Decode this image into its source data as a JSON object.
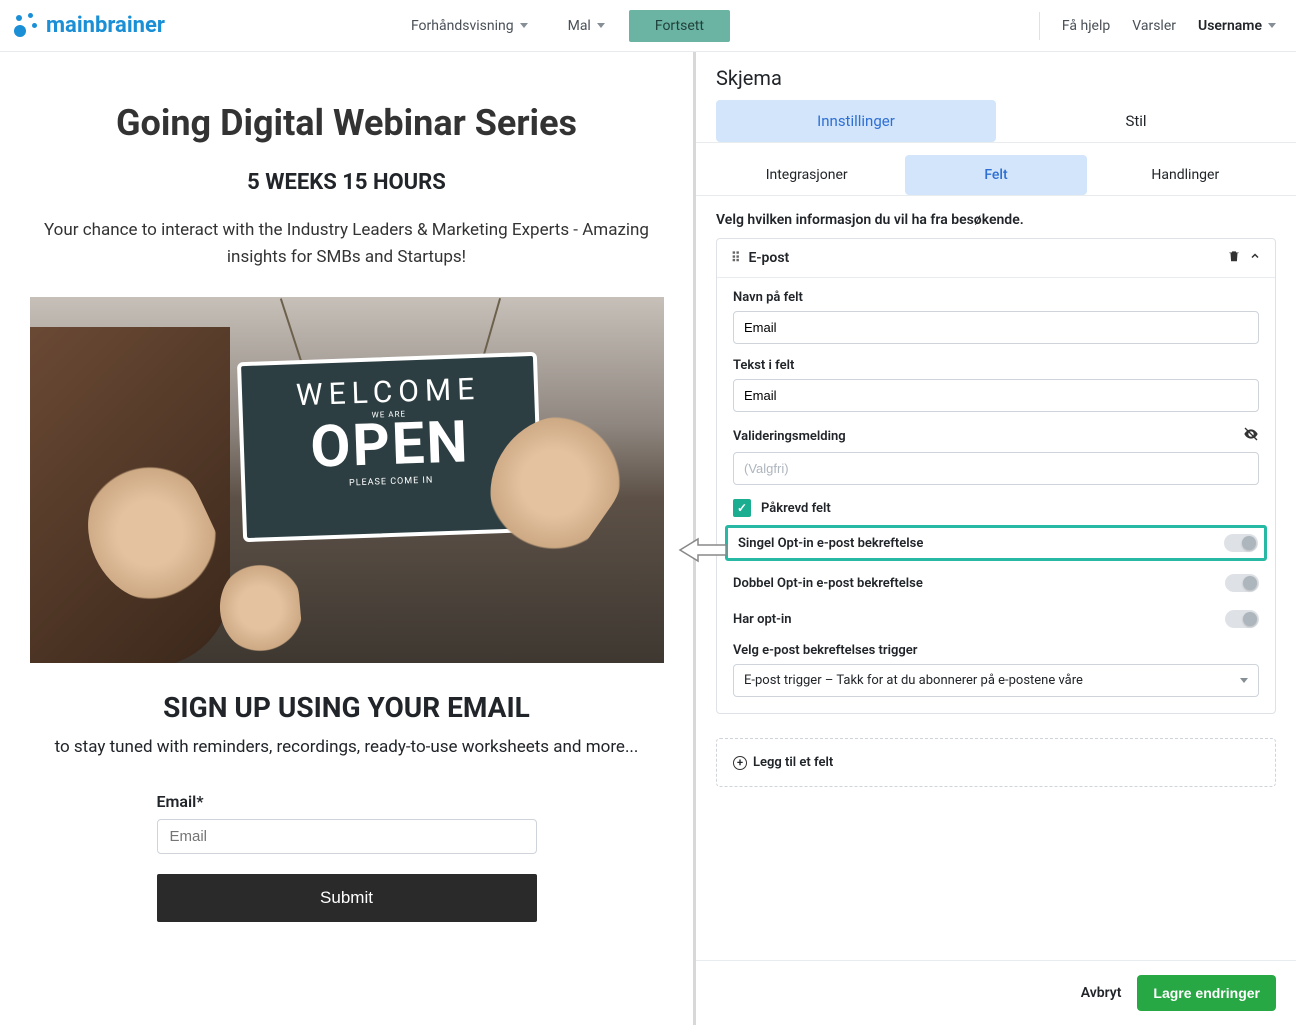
{
  "brand": {
    "name1": "main",
    "name2": "brainer"
  },
  "topnav": {
    "preview_label": "Forhåndsvisning",
    "template_label": "Mal",
    "continue_label": "Fortsett",
    "help_label": "Få hjelp",
    "alerts_label": "Varsler",
    "username_label": "Username"
  },
  "preview": {
    "title": "Going Digital Webinar Series",
    "countdown": "5 WEEKS 15 HOURS",
    "lead": "Your chance to interact with the Industry Leaders & Marketing Experts - Amazing insights for SMBs and Startups!",
    "sign_welcome": "WELCOME",
    "sign_weare": "WE ARE",
    "sign_open": "OPEN",
    "sign_please": "PLEASE COME IN",
    "signup_title": "SIGN UP USING YOUR EMAIL",
    "signup_sub": "to stay tuned with reminders, recordings, ready-to-use worksheets and more...",
    "form_label": "Email*",
    "form_placeholder": "Email",
    "submit_label": "Submit"
  },
  "side": {
    "title": "Skjema",
    "primary_tabs": {
      "settings": "Innstillinger",
      "style": "Stil"
    },
    "secondary_tabs": {
      "integrations": "Integrasjoner",
      "fields": "Felt",
      "actions": "Handlinger"
    },
    "panel_desc": "Velg hvilken informasjon du vil ha fra besøkende.",
    "field": {
      "header": "E-post",
      "name_label": "Navn på felt",
      "name_value": "Email",
      "placeholder_label": "Tekst i felt",
      "placeholder_value": "Email",
      "validation_label": "Valideringsmelding",
      "validation_placeholder": "(Valgfri)",
      "required_label": "Påkrevd felt",
      "single_optin_label": "Singel Opt-in e-post bekreftelse",
      "double_optin_label": "Dobbel Opt-in e-post bekreftelse",
      "has_optin_label": "Har opt-in",
      "trigger_label": "Velg e-post bekreftelses trigger",
      "trigger_value": "E-post trigger – Takk for at du abonnerer på e-postene våre"
    },
    "add_field_label": "Legg til et felt",
    "footer": {
      "cancel": "Avbryt",
      "save": "Lagre endringer"
    }
  }
}
